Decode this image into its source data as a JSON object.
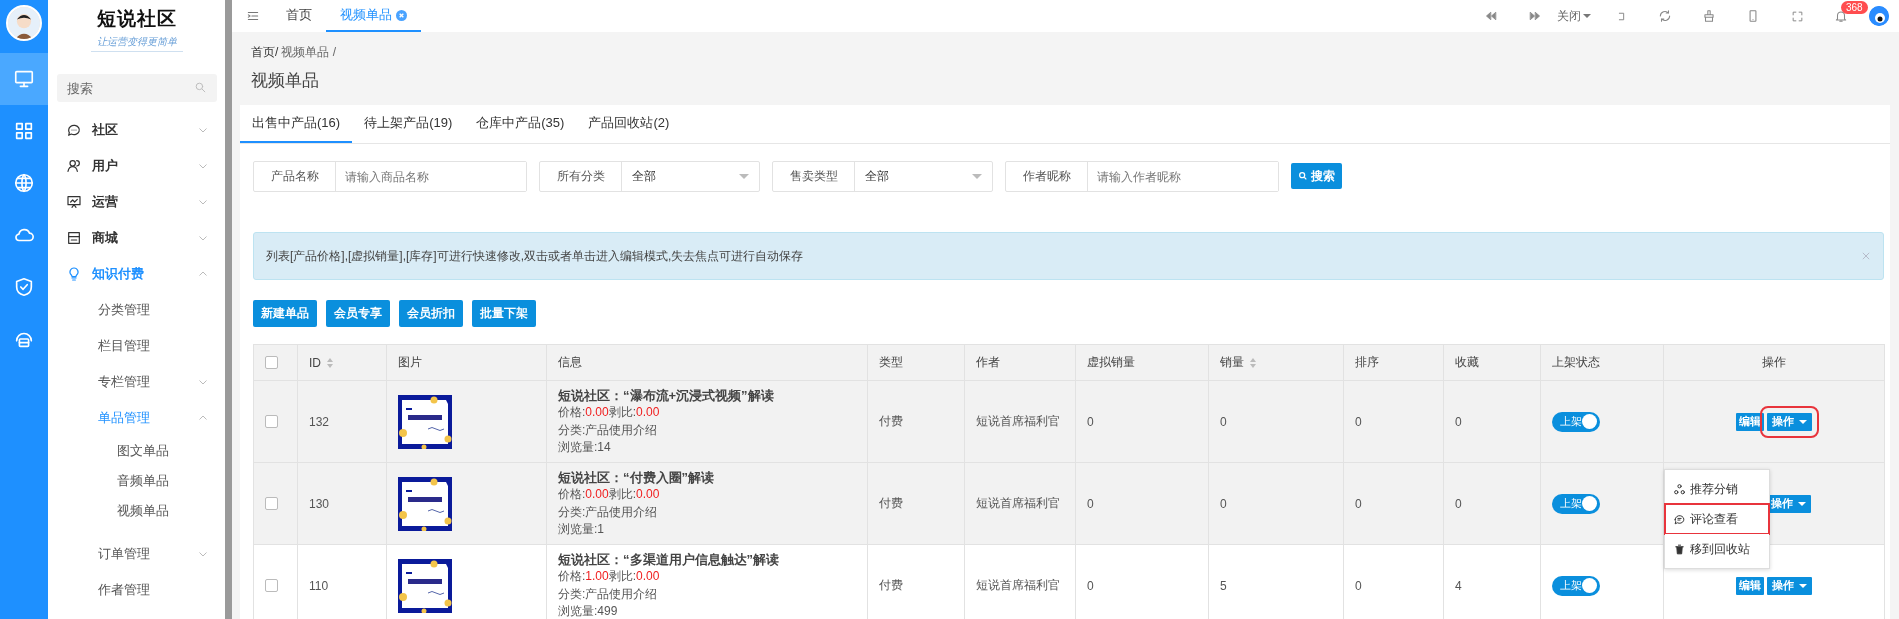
{
  "rail": {
    "items": [
      {
        "kind": "monitor",
        "selected": true
      },
      {
        "kind": "grid",
        "selected": false
      },
      {
        "kind": "globe",
        "selected": false
      },
      {
        "kind": "cloud",
        "selected": false
      },
      {
        "kind": "shield",
        "selected": false
      },
      {
        "kind": "headset",
        "selected": false
      }
    ]
  },
  "sidebar": {
    "logo": "短说社区",
    "slogan": "让运营变得更简单",
    "search": {
      "placeholder": "搜索"
    },
    "items": [
      {
        "label": "社区",
        "kind": "chat",
        "expanded": false,
        "selected": false
      },
      {
        "label": "用户",
        "kind": "user",
        "expanded": false,
        "selected": false
      },
      {
        "label": "运营",
        "kind": "board",
        "expanded": false,
        "selected": false
      },
      {
        "label": "商城",
        "kind": "shop",
        "expanded": false,
        "selected": false
      },
      {
        "label": "知识付费",
        "kind": "bulb",
        "expanded": true,
        "selected": true,
        "children": [
          {
            "label": "分类管理",
            "selected": false
          },
          {
            "label": "栏目管理",
            "selected": false
          },
          {
            "label": "专栏管理",
            "expanded": false,
            "selected": false
          },
          {
            "label": "单品管理",
            "expanded": true,
            "selected": true,
            "children": [
              {
                "label": "图文单品",
                "selected": false
              },
              {
                "label": "音频单品",
                "selected": false
              },
              {
                "label": "视频单品",
                "selected": false
              }
            ]
          },
          {
            "label": "订单管理",
            "expanded": false,
            "selected": false
          },
          {
            "label": "作者管理",
            "selected": false
          }
        ]
      }
    ]
  },
  "topbar": {
    "tabs": [
      {
        "label": "首页",
        "selected": false,
        "closable": false
      },
      {
        "label": "视频单品",
        "selected": true,
        "closable": true
      }
    ],
    "close_menu": "关闭",
    "badge": "368"
  },
  "breadcrumb": [
    "首页/",
    "视频单品 /"
  ],
  "title": "视频单品",
  "tabs": [
    {
      "label": "出售中产品(16)",
      "selected": true
    },
    {
      "label": "待上架产品(19)",
      "selected": false
    },
    {
      "label": "仓库中产品(35)",
      "selected": false
    },
    {
      "label": "产品回收站(2)",
      "selected": false
    }
  ],
  "filters": [
    {
      "label": "产品名称",
      "kind": "input",
      "placeholder": "请输入商品名称"
    },
    {
      "label": "所有分类",
      "kind": "select",
      "value": "全部"
    },
    {
      "label": "售卖类型",
      "kind": "select",
      "value": "全部"
    },
    {
      "label": "作者昵称",
      "kind": "input",
      "placeholder": "请输入作者昵称"
    }
  ],
  "search_button": "搜索",
  "alert": "列表[产品价格],[虚拟销量],[库存]可进行快速修改,双击或者单击进入编辑模式,失去焦点可进行自动保存",
  "actions": [
    "新建单品",
    "会员专享",
    "会员折扣",
    "批量下架"
  ],
  "table": {
    "header_checked": false,
    "columns": [
      {
        "label": "ID",
        "sortable": true
      },
      {
        "label": "图片",
        "sortable": false
      },
      {
        "label": "信息",
        "sortable": false
      },
      {
        "label": "类型",
        "sortable": false
      },
      {
        "label": "作者",
        "sortable": false
      },
      {
        "label": "虚拟销量",
        "sortable": false
      },
      {
        "label": "销量",
        "sortable": true
      },
      {
        "label": "排序",
        "sortable": false
      },
      {
        "label": "收藏",
        "sortable": false
      },
      {
        "label": "上架状态",
        "sortable": false
      },
      {
        "label": "操作",
        "sortable": false
      }
    ],
    "rows": [
      {
        "checked": false,
        "shaded": true,
        "id": "132",
        "title": "短说社区：“瀑布流+沉浸式视频”解读",
        "price_label": "价格:",
        "price": "0.00",
        "ratio_label": "剥比:",
        "ratio": "0.00",
        "category": "分类:产品使用介绍",
        "views": "浏览量:14",
        "type": "付费",
        "author": "短说首席福利官",
        "virtual_sales": "0",
        "sales": "0",
        "sort": "0",
        "favorites": "0",
        "status": {
          "label": "上架",
          "on": true
        },
        "edit": "编辑",
        "ops": "操作",
        "highlight": true
      },
      {
        "checked": false,
        "shaded": true,
        "id": "130",
        "title": "短说社区：“付费入圈”解读",
        "price_label": "价格:",
        "price": "0.00",
        "ratio_label": "剥比:",
        "ratio": "0.00",
        "category": "分类:产品使用介绍",
        "views": "浏览量:1",
        "type": "付费",
        "author": "短说首席福利官",
        "virtual_sales": "0",
        "sales": "0",
        "sort": "0",
        "favorites": "0",
        "status": {
          "label": "上架",
          "on": true
        },
        "ops": "操作",
        "highlight": false,
        "menu": [
          {
            "kind": "share",
            "label": "推荐分销",
            "highlight": false
          },
          {
            "kind": "comment",
            "label": "评论查看",
            "highlight": true
          },
          {
            "kind": "trash",
            "label": "移到回收站",
            "highlight": false
          }
        ]
      },
      {
        "checked": false,
        "shaded": false,
        "id": "110",
        "title": "短说社区：“多渠道用户信息触达”解读",
        "price_label": "价格:",
        "price": "1.00",
        "ratio_label": "剥比:",
        "ratio": "0.00",
        "category": "分类:产品使用介绍",
        "views": "浏览量:499",
        "type": "付费",
        "author": "短说首席福利官",
        "virtual_sales": "0",
        "sales": "5",
        "sort": "0",
        "favorites": "4",
        "status": {
          "label": "上架",
          "on": true
        },
        "edit": "编辑",
        "ops": "操作",
        "highlight": false
      }
    ]
  }
}
